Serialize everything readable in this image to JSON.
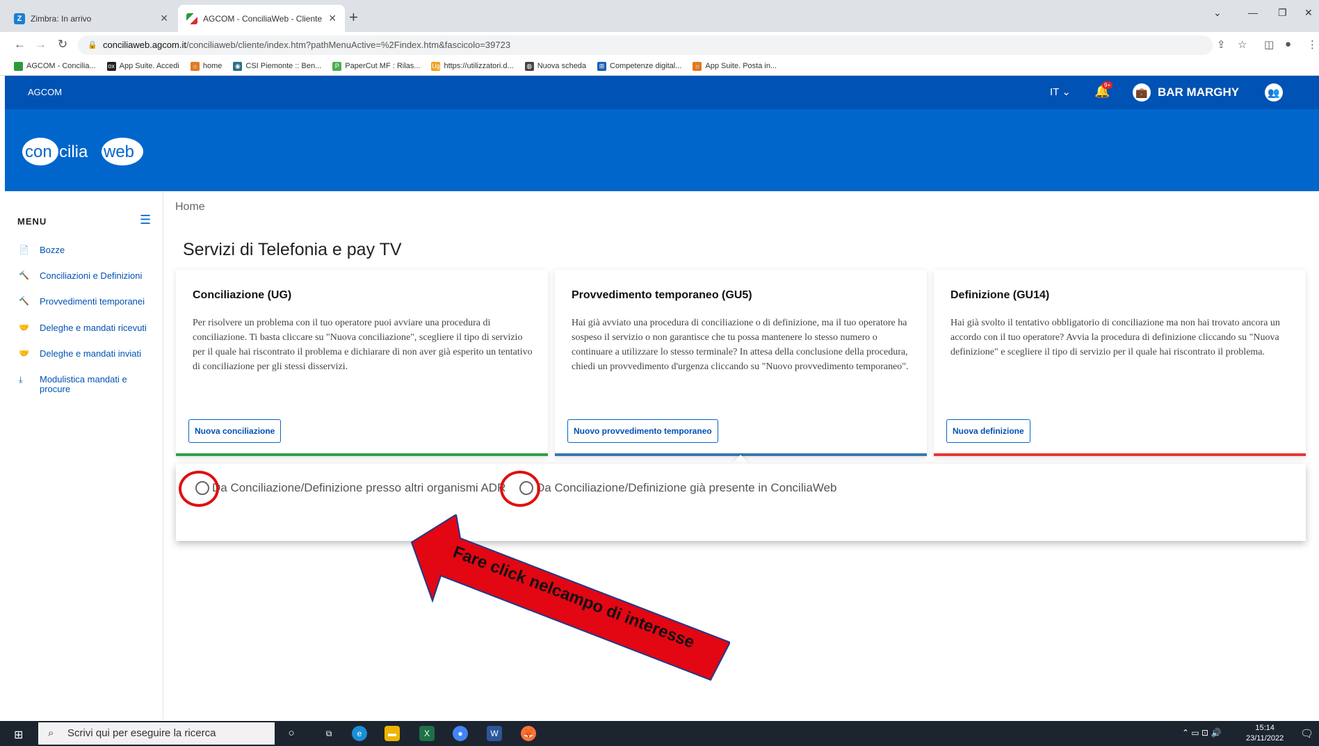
{
  "browser": {
    "tabs": [
      {
        "title": "Zimbra: In arrivo",
        "favicon_color": "#1a7fd4",
        "favicon_letter": "Z"
      },
      {
        "title": "AGCOM - ConciliaWeb - Cliente",
        "favicon_color": "#2c9a3c"
      }
    ],
    "url_host": "conciliaweb.agcom.it",
    "url_path": "/conciliaweb/cliente/index.htm?pathMenuActive=%2Findex.htm&fascicolo=39723",
    "bookmarks": [
      {
        "label": "AGCOM - Concilia...",
        "color": "#2c9a3c",
        "glyph": ""
      },
      {
        "label": "App Suite. Accedi",
        "color": "#222222",
        "glyph": "ox"
      },
      {
        "label": "home",
        "color": "#e07b20",
        "glyph": "☼"
      },
      {
        "label": "CSI Piemonte :: Ben...",
        "color": "#2c6d8a",
        "glyph": "◉"
      },
      {
        "label": "PaperCut MF : Rilas...",
        "color": "#4caf50",
        "glyph": "P"
      },
      {
        "label": "https://utilizzatori.d...",
        "color": "#f0a020",
        "glyph": "Ug"
      },
      {
        "label": "Nuova scheda",
        "color": "#444444",
        "glyph": "◍"
      },
      {
        "label": "Competenze digital...",
        "color": "#1a5fb4",
        "glyph": "⊞"
      },
      {
        "label": "App Suite. Posta in...",
        "color": "#e07b20",
        "glyph": "☼"
      }
    ]
  },
  "header": {
    "org": "AGCOM",
    "lang": "IT ⌄",
    "badge": "9+",
    "user_name": "BAR MARGHY",
    "logo_left": "con",
    "logo_mid": "cilia",
    "logo_right": "web"
  },
  "sidebar": {
    "title": "MENU",
    "items": [
      {
        "label": "Bozze",
        "icon": "📄"
      },
      {
        "label": "Conciliazioni e Definizioni",
        "icon": "🔨"
      },
      {
        "label": "Provvedimenti temporanei",
        "icon": "🔨"
      },
      {
        "label": "Deleghe e mandati ricevuti",
        "icon": "🤝"
      },
      {
        "label": "Deleghe e mandati inviati",
        "icon": "🤝"
      },
      {
        "label": "Modulistica mandati e procure",
        "icon": "⤓"
      }
    ]
  },
  "main": {
    "breadcrumb": "Home",
    "title": "Servizi di Telefonia e pay TV",
    "cards": [
      {
        "title": "Conciliazione (UG)",
        "text": "Per risolvere un problema con il tuo operatore puoi avviare una procedura di conciliazione. Ti basta cliccare su \"Nuova conciliazione\", scegliere il tipo di servizio per il quale hai riscontrato il problema e dichiarare di non aver già esperito un tentativo di conciliazione per gli stessi disservizi.",
        "button": "Nuova conciliazione",
        "accent": "#2ea043"
      },
      {
        "title": "Provvedimento temporaneo (GU5)",
        "text": "Hai già avviato una procedura di conciliazione o di definizione, ma il tuo operatore ha sospeso il servizio o non garantisce che tu possa mantenere lo stesso numero o continuare a utilizzare lo stesso terminale? In attesa della conclusione della procedura, chiedi un provvedimento d'urgenza cliccando su \"Nuovo provvedimento temporaneo\".",
        "button": "Nuovo provvedimento temporaneo",
        "accent": "#3a78b0"
      },
      {
        "title": "Definizione (GU14)",
        "text": "Hai già svolto il tentativo obbligatorio di conciliazione ma non hai trovato ancora un accordo con il tuo operatore? Avvia la procedura di definizione cliccando su \"Nuova definizione\" e scegliere il tipo di servizio per il quale hai riscontrato il problema.",
        "button": "Nuova definizione",
        "accent": "#e53935"
      }
    ],
    "options": [
      "Da Conciliazione/Definizione presso altri organismi ADR",
      "Da Conciliazione/Definizione già presente in ConciliaWeb"
    ],
    "annotation": "Fare click nelcampo di interesse"
  },
  "taskbar": {
    "search_placeholder": "Scrivi qui per eseguire la ricerca",
    "time": "15:14",
    "date": "23/11/2022"
  }
}
